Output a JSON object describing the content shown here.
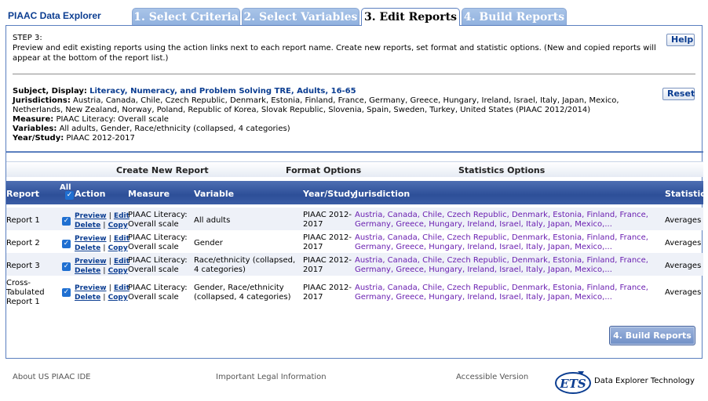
{
  "app": {
    "title": "PIAAC Data Explorer"
  },
  "tabs": [
    {
      "label": "1. Select Criteria",
      "active": false
    },
    {
      "label": "2. Select Variables",
      "active": false
    },
    {
      "label": "3. Edit Reports",
      "active": true
    },
    {
      "label": "4. Build Reports",
      "active": false
    }
  ],
  "step": {
    "title": "STEP 3:",
    "description": "Preview and edit existing reports using the action links next to each report name. Create new reports, set format and statistic options. (New and copied reports will appear at the bottom of the report list.)",
    "help_label": "Help",
    "reset_label": "Reset"
  },
  "summary": {
    "subject_key": "Subject, Display:",
    "subject_val": "Literacy, Numeracy, and Problem Solving TRE, Adults, 16-65",
    "jurisdictions_key": "Jurisdictions:",
    "jurisdictions_val": "Austria, Canada, Chile, Czech Republic, Denmark, Estonia, Finland, France, Germany, Greece, Hungary, Ireland, Israel, Italy, Japan, Mexico, Netherlands, New Zealand, Norway, Poland, Republic of Korea, Slovak Republic, Slovenia, Spain, Sweden, Turkey, United States (PIAAC 2012/2014)",
    "measure_key": "Measure:",
    "measure_val": "PIAAC Literacy: Overall scale",
    "variables_key": "Variables:",
    "variables_val": "All adults, Gender, Race/ethnicity (collapsed, 4 categories)",
    "year_key": "Year/Study:",
    "year_val": "PIAAC 2012-2017"
  },
  "options": {
    "create": "Create New Report",
    "format": "Format Options",
    "statistics": "Statistics Options"
  },
  "table": {
    "headers": {
      "report": "Report",
      "all": "All",
      "action": "Action",
      "measure": "Measure",
      "variable": "Variable",
      "year": "Year/Study",
      "jurisdiction": "Jurisdiction",
      "statistic": "Statistic"
    },
    "action_labels": {
      "preview": "Preview",
      "edit": "Edit",
      "delete": "Delete",
      "copy": "Copy"
    },
    "rows": [
      {
        "report": "Report 1",
        "measure": "PIAAC Literacy: Overall scale",
        "variable": "All adults",
        "year": "PIAAC 2012-2017",
        "jurisdiction": "Austria, Canada, Chile, Czech Republic, Denmark, Estonia, Finland, France, Germany, Greece, Hungary, Ireland, Israel, Italy, Japan, Mexico,...",
        "statistic": "Averages"
      },
      {
        "report": "Report 2",
        "measure": "PIAAC Literacy: Overall scale",
        "variable": "Gender",
        "year": "PIAAC 2012-2017",
        "jurisdiction": "Austria, Canada, Chile, Czech Republic, Denmark, Estonia, Finland, France, Germany, Greece, Hungary, Ireland, Israel, Italy, Japan, Mexico,...",
        "statistic": "Averages"
      },
      {
        "report": "Report 3",
        "measure": "PIAAC Literacy: Overall scale",
        "variable": "Race/ethnicity (collapsed, 4 categories)",
        "year": "PIAAC 2012-2017",
        "jurisdiction": "Austria, Canada, Chile, Czech Republic, Denmark, Estonia, Finland, France, Germany, Greece, Hungary, Ireland, Israel, Italy, Japan, Mexico,...",
        "statistic": "Averages"
      },
      {
        "report": "Cross-Tabulated Report 1",
        "measure": "PIAAC Literacy: Overall scale",
        "variable": "Gender, Race/ethnicity (collapsed, 4 categories)",
        "year": "PIAAC 2012-2017",
        "jurisdiction": "Austria, Canada, Chile, Czech Republic, Denmark, Estonia, Finland, France, Germany, Greece, Hungary, Ireland, Israel, Italy, Japan, Mexico,...",
        "statistic": "Averages"
      }
    ]
  },
  "build_button": "4. Build Reports",
  "footer": {
    "about": "About US PIAAC IDE",
    "legal": "Important Legal Information",
    "accessible": "Accessible Version",
    "logo_text": "ETS",
    "tech": "Data Explorer Technology"
  },
  "colors": {
    "brand": "#0b3d91",
    "header_blue": "#2d4f98",
    "link_purple": "#6a1fb0",
    "tab_inactive": "#8fb0de"
  }
}
